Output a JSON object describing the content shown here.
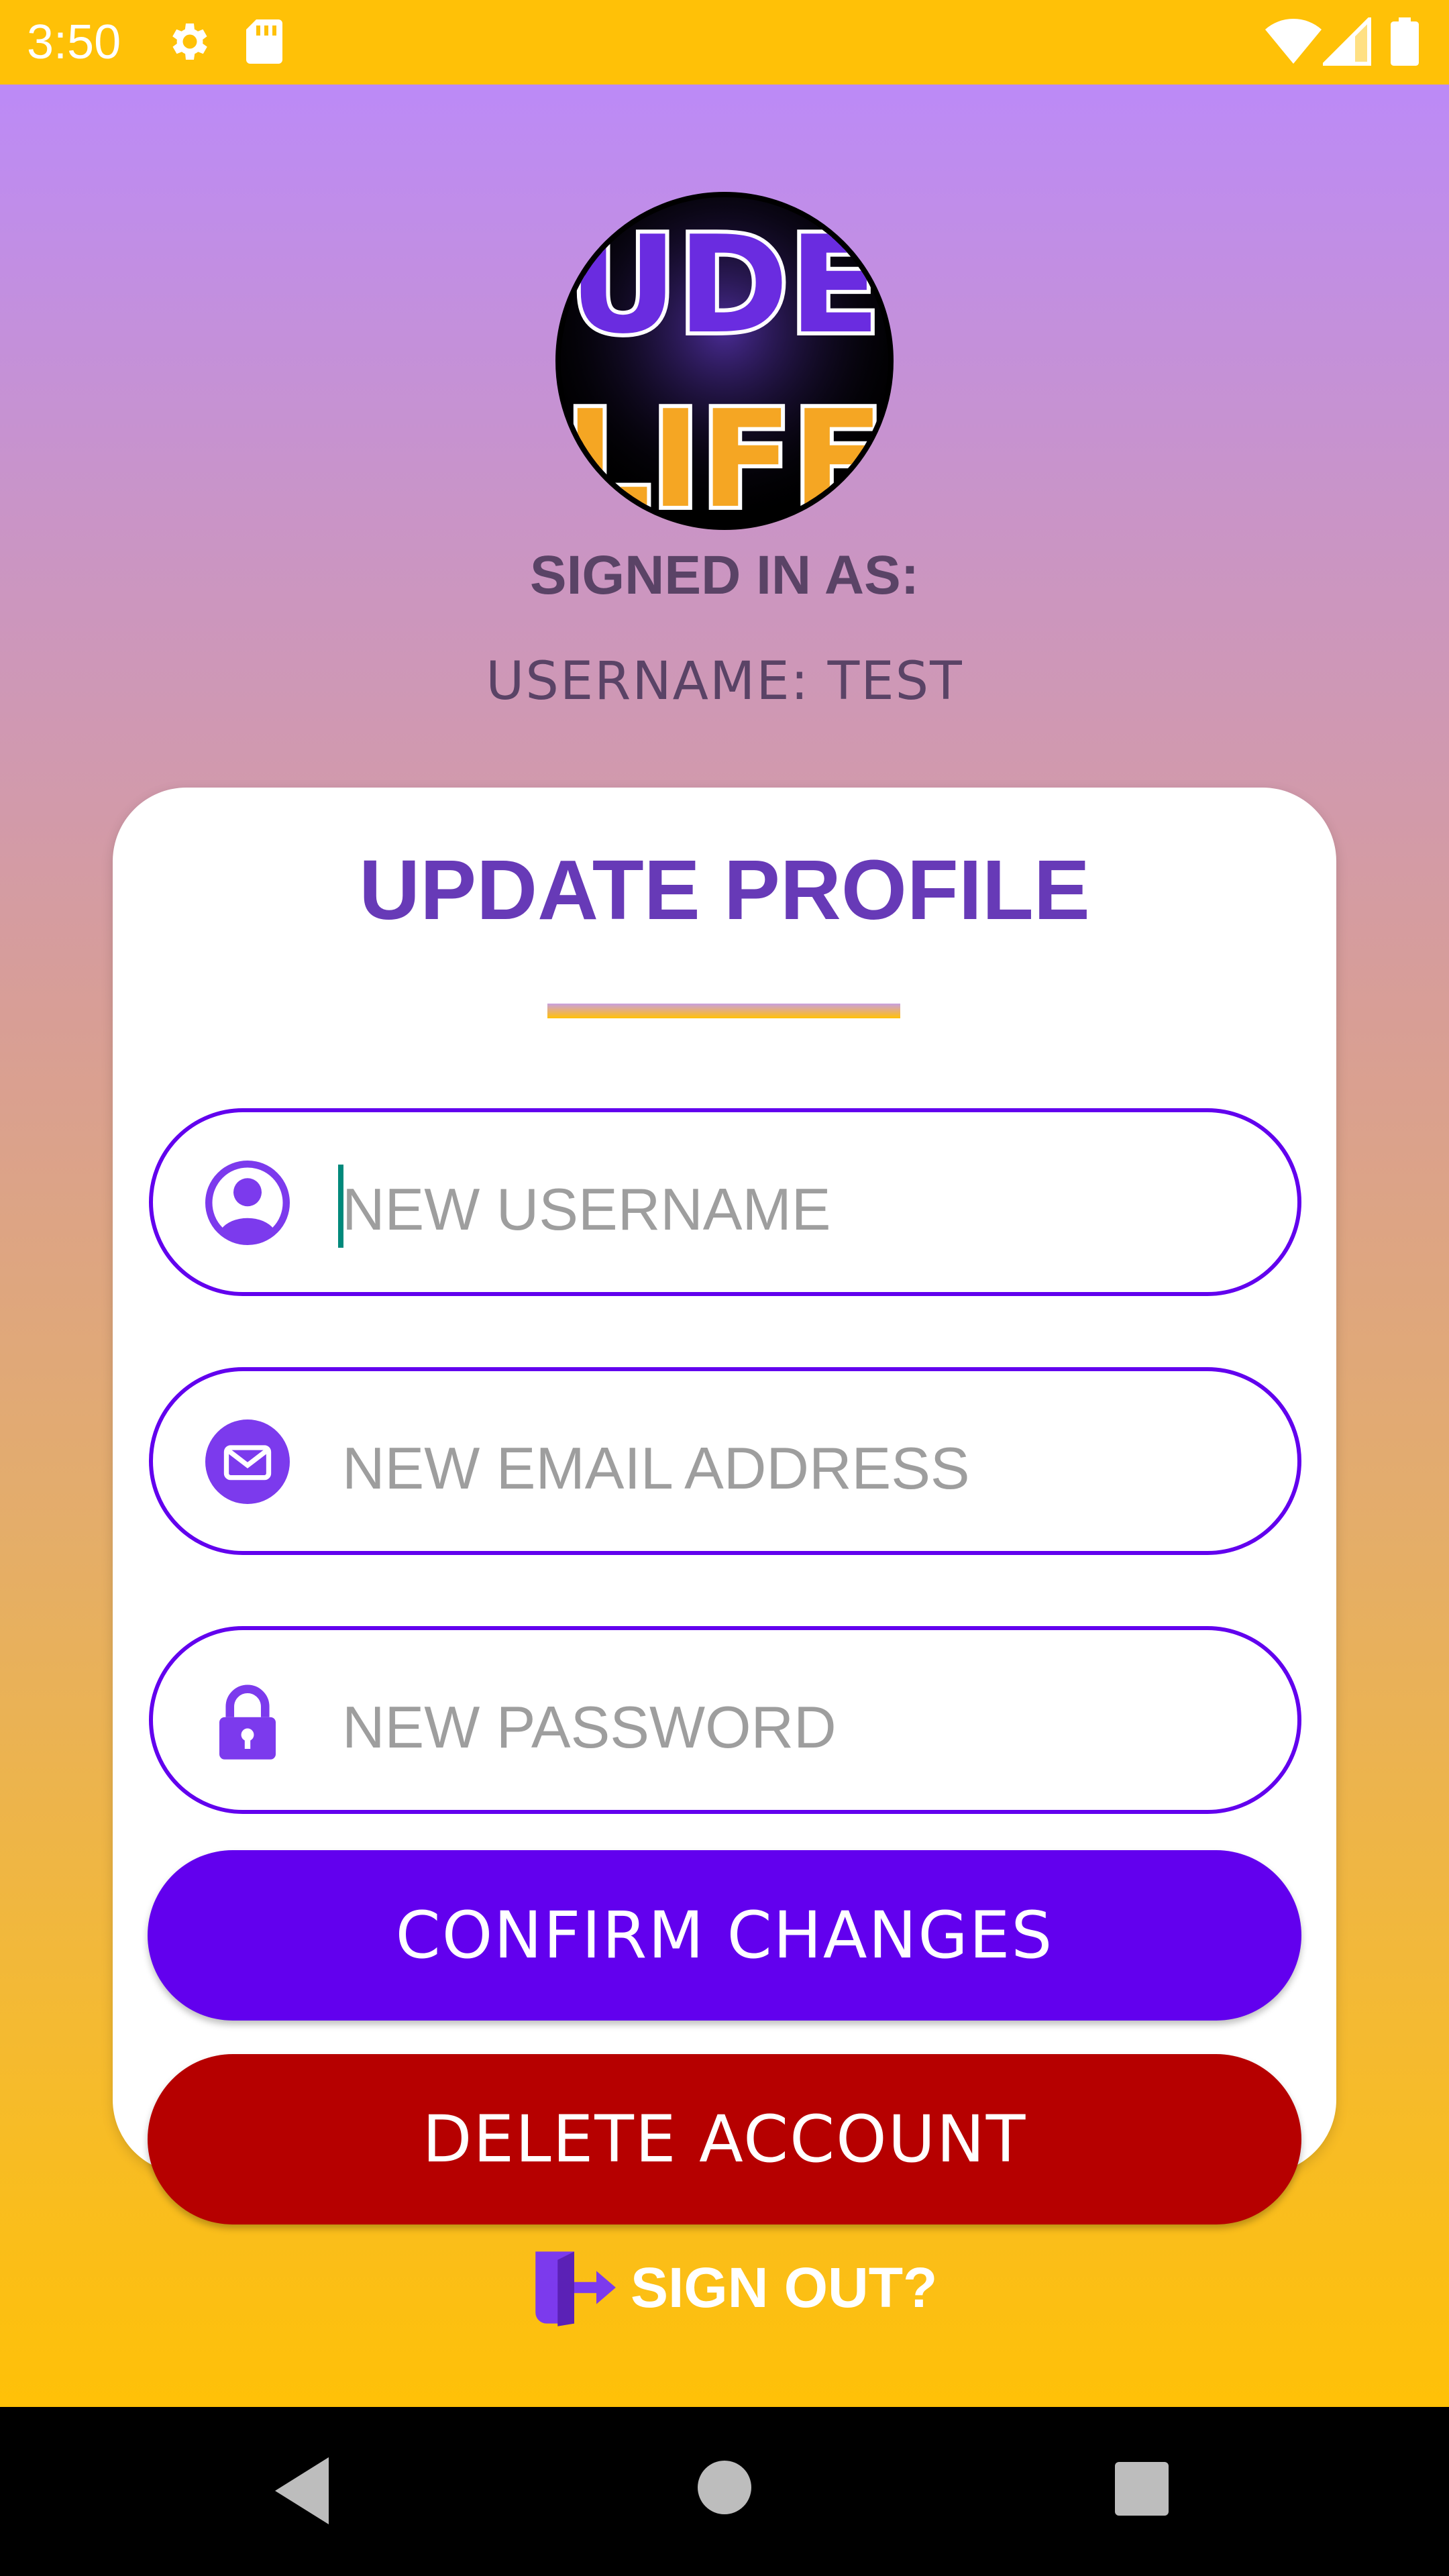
{
  "status_bar": {
    "time": "3:50",
    "icons": [
      "gear-icon",
      "sd-card-icon",
      "wifi-icon",
      "cell-signal-icon",
      "battery-icon"
    ]
  },
  "header": {
    "avatar_text_top": "UDE",
    "avatar_text_bottom": "LIFE",
    "signed_in_label": "SIGNED IN AS:",
    "username_line": "USERNAME: TEST"
  },
  "card": {
    "title": "UPDATE PROFILE",
    "fields": [
      {
        "icon": "user-icon",
        "placeholder": "NEW USERNAME",
        "value": ""
      },
      {
        "icon": "mail-icon",
        "placeholder": "NEW EMAIL ADDRESS",
        "value": ""
      },
      {
        "icon": "lock-icon",
        "placeholder": "NEW PASSWORD",
        "value": ""
      }
    ],
    "confirm_label": "CONFIRM CHANGES",
    "delete_label": "DELETE ACCOUNT"
  },
  "signout": {
    "icon": "exit-door-icon",
    "label": "SIGN OUT?"
  },
  "nav": {
    "icons": [
      "back-icon",
      "home-icon",
      "recents-icon"
    ]
  },
  "colors": {
    "status_bar": "#FFC107",
    "accent_purple": "#6200EE",
    "title_purple": "#673AB7",
    "delete_red": "#B60000"
  }
}
